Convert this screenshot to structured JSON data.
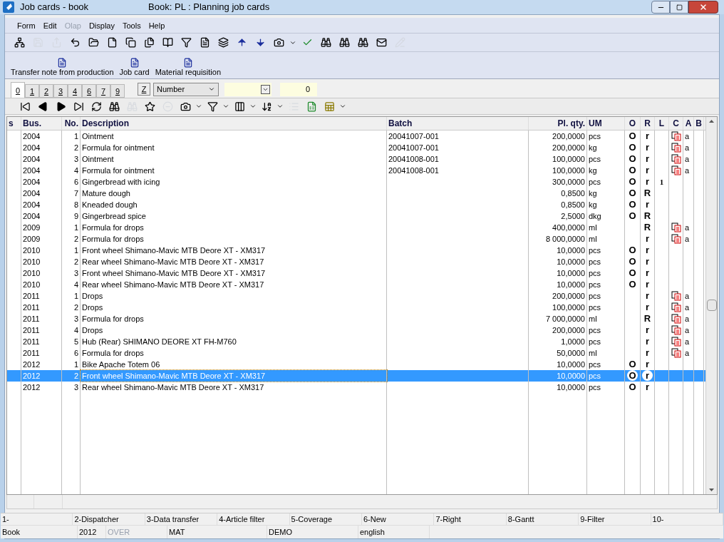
{
  "window": {
    "title": "Job cards - book",
    "subtitle": "Book: PL : Planning job cards"
  },
  "menu": [
    {
      "label": "Form",
      "disabled": false
    },
    {
      "label": "Edit",
      "disabled": false
    },
    {
      "label": "Olap",
      "disabled": true
    },
    {
      "label": "Display",
      "disabled": false
    },
    {
      "label": "Tools",
      "disabled": false
    },
    {
      "label": "Help",
      "disabled": false
    }
  ],
  "toolbar": [
    {
      "kind": "tree",
      "disabled": false
    },
    {
      "kind": "save",
      "disabled": true
    },
    {
      "kind": "export",
      "disabled": true
    },
    {
      "kind": "undo",
      "disabled": false
    },
    {
      "kind": "folder",
      "disabled": false
    },
    {
      "kind": "page",
      "disabled": false
    },
    {
      "kind": "copy",
      "disabled": false
    },
    {
      "kind": "files",
      "disabled": false
    },
    {
      "kind": "book",
      "disabled": false
    },
    {
      "kind": "filter",
      "disabled": false
    },
    {
      "kind": "filter-doc",
      "disabled": false
    },
    {
      "kind": "layers",
      "disabled": false
    },
    {
      "kind": "up",
      "disabled": false
    },
    {
      "kind": "down",
      "disabled": false
    },
    {
      "kind": "camera",
      "disabled": false
    },
    {
      "kind": "caret",
      "disabled": false
    },
    {
      "kind": "check",
      "disabled": false
    },
    {
      "kind": "binoculars",
      "disabled": false
    },
    {
      "kind": "binoculars",
      "disabled": false
    },
    {
      "kind": "binoculars",
      "disabled": false
    },
    {
      "kind": "mail",
      "disabled": false
    },
    {
      "kind": "edit",
      "disabled": true
    }
  ],
  "reports": [
    "Transfer note from production",
    "Job card",
    "Material requisition"
  ],
  "tabs": [
    {
      "label": "0",
      "selected": true
    },
    {
      "label": "1",
      "selected": false
    },
    {
      "label": "2",
      "selected": false
    },
    {
      "label": "3",
      "selected": false
    },
    {
      "label": "4",
      "selected": false
    },
    {
      "label": "6",
      "selected": false
    },
    {
      "label": "7",
      "selected": false
    },
    {
      "label": "9",
      "selected": false
    }
  ],
  "sort_button": "Z",
  "sort_select": "Number",
  "filter_count": "0",
  "nav_toolbar": [
    {
      "kind": "first",
      "disabled": false
    },
    {
      "kind": "prev",
      "disabled": false
    },
    {
      "kind": "next",
      "disabled": false
    },
    {
      "kind": "last",
      "disabled": false
    },
    {
      "kind": "refresh",
      "disabled": false
    },
    {
      "kind": "binoculars",
      "disabled": false
    },
    {
      "kind": "binoculars",
      "disabled": true
    },
    {
      "kind": "star-add",
      "disabled": false
    },
    {
      "kind": "remove",
      "disabled": true
    },
    {
      "kind": "camera",
      "disabled": false
    },
    {
      "kind": "caret",
      "disabled": false
    },
    {
      "kind": "filter",
      "disabled": false
    },
    {
      "kind": "caret",
      "disabled": false
    },
    {
      "kind": "columns",
      "disabled": false
    },
    {
      "kind": "caret",
      "disabled": false
    },
    {
      "kind": "sort",
      "disabled": false
    },
    {
      "kind": "caret",
      "disabled": false
    },
    {
      "kind": "list",
      "disabled": true
    },
    {
      "kind": "excel",
      "disabled": false
    },
    {
      "kind": "sheet",
      "disabled": false
    },
    {
      "kind": "caret",
      "disabled": false
    }
  ],
  "table": {
    "columns": [
      "s",
      "Bus.",
      "No.",
      "Description",
      "Batch",
      "Pl. qty.",
      "UM",
      "O",
      "R",
      "L",
      "C",
      "A",
      "B"
    ],
    "rows": [
      {
        "bus": "2004",
        "no": "1",
        "description": "Ointment",
        "batch": "20041007-001",
        "qty": "200,0000",
        "um": "pcs",
        "o": "O",
        "r": "r",
        "l": "",
        "c": true,
        "a": "a",
        "selected": false
      },
      {
        "bus": "2004",
        "no": "2",
        "description": "Formula for ointment",
        "batch": "20041007-001",
        "qty": "200,0000",
        "um": "kg",
        "o": "O",
        "r": "r",
        "l": "",
        "c": true,
        "a": "a",
        "selected": false
      },
      {
        "bus": "2004",
        "no": "3",
        "description": "Ointment",
        "batch": "20041008-001",
        "qty": "100,0000",
        "um": "pcs",
        "o": "O",
        "r": "r",
        "l": "",
        "c": true,
        "a": "a",
        "selected": false
      },
      {
        "bus": "2004",
        "no": "4",
        "description": "Formula for ointment",
        "batch": "20041008-001",
        "qty": "100,0000",
        "um": "kg",
        "o": "O",
        "r": "r",
        "l": "",
        "c": true,
        "a": "a",
        "selected": false
      },
      {
        "bus": "2004",
        "no": "6",
        "description": "Gingerbread with icing",
        "batch": "",
        "qty": "300,0000",
        "um": "pcs",
        "o": "O",
        "r": "r",
        "l": "1",
        "c": false,
        "a": "",
        "selected": false
      },
      {
        "bus": "2004",
        "no": "7",
        "description": "Mature dough",
        "batch": "",
        "qty": "0,8500",
        "um": "kg",
        "o": "O",
        "r": "R",
        "l": "",
        "c": false,
        "a": "",
        "selected": false
      },
      {
        "bus": "2004",
        "no": "8",
        "description": "Kneaded dough",
        "batch": "",
        "qty": "0,8500",
        "um": "kg",
        "o": "O",
        "r": "r",
        "l": "",
        "c": false,
        "a": "",
        "selected": false
      },
      {
        "bus": "2004",
        "no": "9",
        "description": "Gingerbread spice",
        "batch": "",
        "qty": "2,5000",
        "um": "dkg",
        "o": "O",
        "r": "R",
        "l": "",
        "c": false,
        "a": "",
        "selected": false
      },
      {
        "bus": "2009",
        "no": "1",
        "description": "Formula for drops",
        "batch": "",
        "qty": "400,0000",
        "um": "ml",
        "o": "",
        "r": "R",
        "l": "",
        "c": true,
        "a": "a",
        "selected": false
      },
      {
        "bus": "2009",
        "no": "2",
        "description": "Formula for drops",
        "batch": "",
        "qty": "8 000,0000",
        "um": "ml",
        "o": "",
        "r": "r",
        "l": "",
        "c": true,
        "a": "a",
        "selected": false
      },
      {
        "bus": "2010",
        "no": "1",
        "description": "Front wheel Shimano-Mavic MTB Deore XT - XM317",
        "batch": "",
        "qty": "10,0000",
        "um": "pcs",
        "o": "O",
        "r": "r",
        "l": "",
        "c": false,
        "a": "",
        "selected": false
      },
      {
        "bus": "2010",
        "no": "2",
        "description": "Rear wheel Shimano-Mavic MTB Deore XT - XM317",
        "batch": "",
        "qty": "10,0000",
        "um": "pcs",
        "o": "O",
        "r": "r",
        "l": "",
        "c": false,
        "a": "",
        "selected": false
      },
      {
        "bus": "2010",
        "no": "3",
        "description": "Front wheel Shimano-Mavic MTB Deore XT - XM317",
        "batch": "",
        "qty": "10,0000",
        "um": "pcs",
        "o": "O",
        "r": "r",
        "l": "",
        "c": false,
        "a": "",
        "selected": false
      },
      {
        "bus": "2010",
        "no": "4",
        "description": "Rear wheel Shimano-Mavic MTB Deore XT - XM317",
        "batch": "",
        "qty": "10,0000",
        "um": "pcs",
        "o": "O",
        "r": "r",
        "l": "",
        "c": false,
        "a": "",
        "selected": false
      },
      {
        "bus": "2011",
        "no": "1",
        "description": "Drops",
        "batch": "",
        "qty": "200,0000",
        "um": "pcs",
        "o": "",
        "r": "r",
        "l": "",
        "c": true,
        "a": "a",
        "selected": false
      },
      {
        "bus": "2011",
        "no": "2",
        "description": "Drops",
        "batch": "",
        "qty": "100,0000",
        "um": "pcs",
        "o": "",
        "r": "r",
        "l": "",
        "c": true,
        "a": "a",
        "selected": false
      },
      {
        "bus": "2011",
        "no": "3",
        "description": "Formula for drops",
        "batch": "",
        "qty": "7 000,0000",
        "um": "ml",
        "o": "",
        "r": "R",
        "l": "",
        "c": true,
        "a": "a",
        "selected": false
      },
      {
        "bus": "2011",
        "no": "4",
        "description": "Drops",
        "batch": "",
        "qty": "200,0000",
        "um": "pcs",
        "o": "",
        "r": "r",
        "l": "",
        "c": true,
        "a": "a",
        "selected": false
      },
      {
        "bus": "2011",
        "no": "5",
        "description": "Hub (Rear) SHIMANO DEORE XT FH-M760",
        "batch": "",
        "qty": "1,0000",
        "um": "pcs",
        "o": "",
        "r": "r",
        "l": "",
        "c": true,
        "a": "a",
        "selected": false
      },
      {
        "bus": "2011",
        "no": "6",
        "description": "Formula for drops",
        "batch": "",
        "qty": "50,0000",
        "um": "ml",
        "o": "",
        "r": "r",
        "l": "",
        "c": true,
        "a": "a",
        "selected": false
      },
      {
        "bus": "2012",
        "no": "1",
        "description": "Bike Apache Totem 06",
        "batch": "",
        "qty": "10,0000",
        "um": "pcs",
        "o": "O",
        "r": "r",
        "l": "",
        "c": false,
        "a": "",
        "selected": false
      },
      {
        "bus": "2012",
        "no": "2",
        "description": "Front wheel Shimano-Mavic MTB Deore XT - XM317",
        "batch": "",
        "qty": "10,0000",
        "um": "pcs",
        "o": "O",
        "r": "r",
        "l": "",
        "c": false,
        "a": "",
        "selected": true
      },
      {
        "bus": "2012",
        "no": "3",
        "description": "Rear wheel Shimano-Mavic MTB Deore XT - XM317",
        "batch": "",
        "qty": "10,0000",
        "um": "pcs",
        "o": "O",
        "r": "r",
        "l": "",
        "c": false,
        "a": "",
        "selected": false
      }
    ]
  },
  "function_keys": [
    "1-",
    "2-Dispatcher",
    "3-Data transfer",
    "4-Article filter",
    "5-Coverage",
    "6-New",
    "7-Right",
    "8-Gantt",
    "9-Filter",
    "10-"
  ],
  "status_bar": [
    {
      "text": "Book",
      "disabled": false
    },
    {
      "text": "2012",
      "disabled": false
    },
    {
      "text": "OVER",
      "disabled": true
    },
    {
      "text": "MAT",
      "disabled": false
    },
    {
      "text": "DEMO",
      "disabled": false
    },
    {
      "text": "english",
      "disabled": false
    }
  ]
}
